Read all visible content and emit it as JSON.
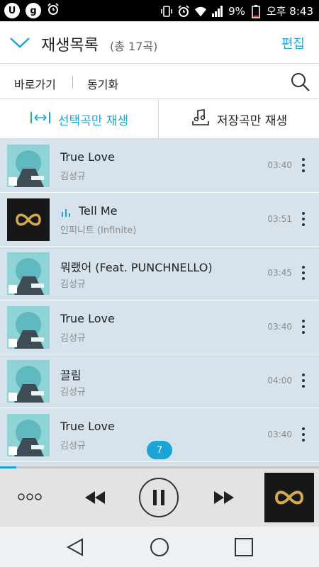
{
  "status_bar": {
    "battery": "9%",
    "time": "오후 8:43",
    "left_icons": [
      "u-plus-icon",
      "g-circle-icon",
      "alarm-icon"
    ],
    "right_icons": [
      "vibrate-icon",
      "alarm-icon",
      "wifi-icon",
      "signal-icon",
      "battery-icon"
    ]
  },
  "header": {
    "title": "재생목록",
    "count": "(총 17곡)",
    "edit": "편집"
  },
  "shortcuts": {
    "goto": "바로가기",
    "sync": "동기화"
  },
  "modes": {
    "selected_only": "선택곡만 재생",
    "saved_only": "저장곡만 재생"
  },
  "songs": [
    {
      "title": "True Love",
      "artist": "김성규",
      "duration": "03:40",
      "art": "teal-cover",
      "playing": false
    },
    {
      "title": "Tell Me",
      "artist": "인피니트 (Infinite)",
      "duration": "03:51",
      "art": "infinity-cover",
      "playing": true
    },
    {
      "title": "뭐랬어 (Feat. PUNCHNELLO)",
      "artist": "김성규",
      "duration": "03:45",
      "art": "teal-cover",
      "playing": false
    },
    {
      "title": "True Love",
      "artist": "김성규",
      "duration": "03:40",
      "art": "teal-cover",
      "playing": false
    },
    {
      "title": "끌림",
      "artist": "김성규",
      "duration": "04:00",
      "art": "teal-cover",
      "playing": false
    },
    {
      "title": "True Love",
      "artist": "김성규",
      "duration": "03:40",
      "art": "teal-cover",
      "playing": false
    }
  ],
  "scroll_badge": "7",
  "player": {
    "progress_fraction": 0.05
  },
  "colors": {
    "accent": "#1aa5d6",
    "list_background": "#d6e3ec",
    "player_background": "#e3e3e3",
    "infinity_gold": "#d6a94a"
  }
}
